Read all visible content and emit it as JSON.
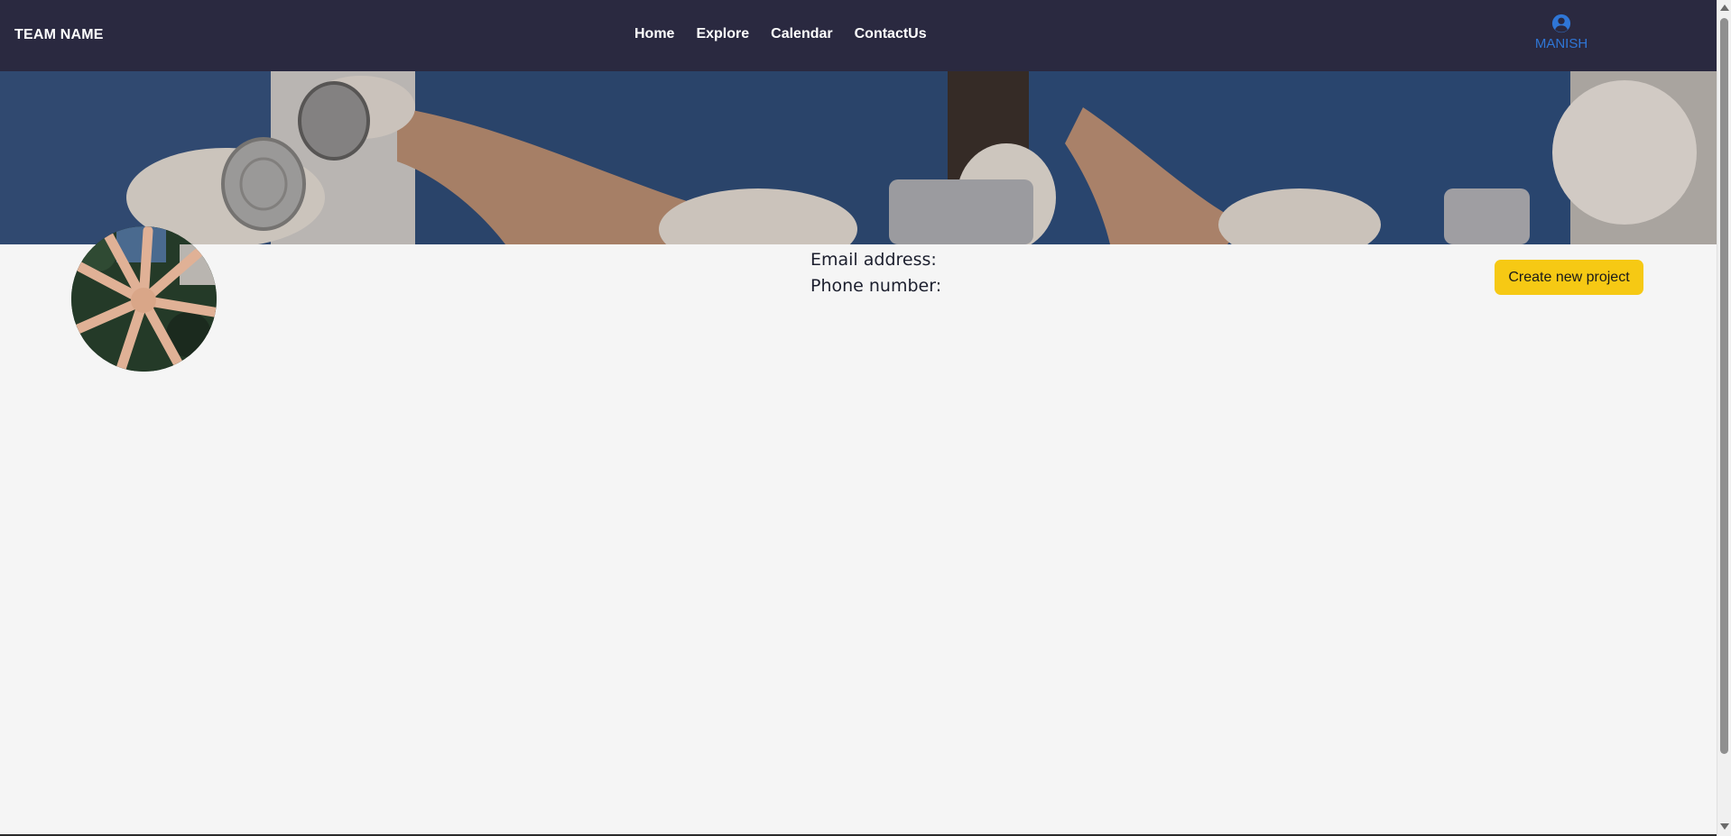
{
  "navbar": {
    "brand": "TEAM NAME",
    "links": [
      "Home",
      "Explore",
      "Calendar",
      "ContactUs"
    ],
    "user": {
      "name": "MANISH",
      "icon": "user-circle-icon"
    }
  },
  "banner": {
    "image": "volunteers-cans-banner"
  },
  "profile": {
    "avatar": "team-hands-circle",
    "email_label": "Email address:",
    "phone_label": "Phone number:"
  },
  "actions": {
    "create_label": "Create new project"
  },
  "colors": {
    "navbar_bg": "#2a2940",
    "user_accent": "#2f76d6",
    "button_bg": "#f6c914",
    "page_bg": "#f5f5f5"
  }
}
